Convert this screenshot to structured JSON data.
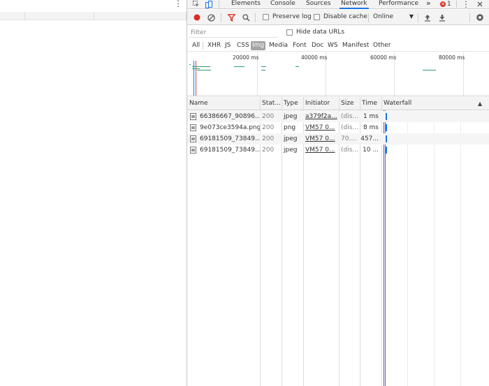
{
  "left_page": {
    "menu_glyph": "⋮"
  },
  "tabs": [
    {
      "label": "Elements",
      "active": false
    },
    {
      "label": "Console",
      "active": false
    },
    {
      "label": "Sources",
      "active": false
    },
    {
      "label": "Network",
      "active": true
    },
    {
      "label": "Performance",
      "active": false
    }
  ],
  "tabbar": {
    "more_glyph": "»",
    "error_count": "1",
    "error_glyph": "✕",
    "menu_glyph": "⋮"
  },
  "toolbar": {
    "preserve_log": "Preserve log",
    "disable_cache": "Disable cache",
    "throttling": "Online",
    "throttling_arrow": "▼"
  },
  "filter": {
    "placeholder": "Filter",
    "value": "",
    "hide_data_urls": "Hide data URLs"
  },
  "type_filters": [
    {
      "label": "All",
      "active": false
    },
    {
      "label": "XHR",
      "active": false
    },
    {
      "label": "JS",
      "active": false
    },
    {
      "label": "CSS",
      "active": false
    },
    {
      "label": "Img",
      "active": true
    },
    {
      "label": "Media",
      "active": false
    },
    {
      "label": "Font",
      "active": false
    },
    {
      "label": "Doc",
      "active": false
    },
    {
      "label": "WS",
      "active": false
    },
    {
      "label": "Manifest",
      "active": false
    },
    {
      "label": "Other",
      "active": false
    }
  ],
  "overview": {
    "labels": [
      "20000 ms",
      "40000 ms",
      "60000 ms",
      "80000 ms"
    ]
  },
  "columns": {
    "name": "Name",
    "status": "Stat...",
    "type": "Type",
    "initiator": "Initiator",
    "size": "Size",
    "time": "Time",
    "waterfall": "Waterfall",
    "sort_glyph": "▲"
  },
  "requests": [
    {
      "name": "66386667_90896...",
      "status": "200",
      "type": "jpeg",
      "initiator": "a379f2a...",
      "size": "(dis...",
      "time": "1 ms"
    },
    {
      "name": "9e073ce3594a.png",
      "status": "200",
      "type": "png",
      "initiator": "VM57 0...",
      "size": "(dis...",
      "time": "8 ms"
    },
    {
      "name": "69181509_73849...",
      "status": "200",
      "type": "jpeg",
      "initiator": "VM57 0...",
      "size": "70....",
      "time": "457..."
    },
    {
      "name": "69181509_73849...",
      "status": "200",
      "type": "jpeg",
      "initiator": "VM57 0...",
      "size": "(dis...",
      "time": "10 ..."
    }
  ],
  "colors": {
    "accent": "#1a73e8",
    "record": "#d93025",
    "filter_active": "#d93025",
    "overview_bar": "#2e9e6b",
    "domcontentloaded": "#1a73e8",
    "load": "#e04040"
  }
}
